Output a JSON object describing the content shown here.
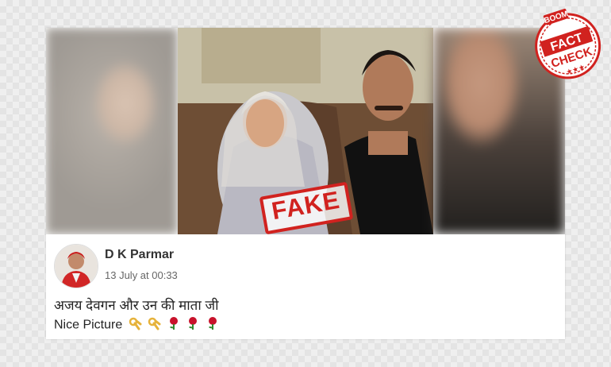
{
  "badge": {
    "top_text": "BOOM",
    "word1": "FACT",
    "word2": "CHECK",
    "stars": "★★★"
  },
  "stamp": {
    "label": "FAKE"
  },
  "post": {
    "author": "D K Parmar",
    "timestamp": "13 July at 00:33",
    "line1": "अजय देवगन और उन की माता जी",
    "line2": "Nice Picture",
    "emoji": [
      "ok-hand",
      "ok-hand",
      "rose",
      "rose",
      "rose"
    ]
  },
  "colors": {
    "stamp_red": "#d1221f",
    "text": "#222222",
    "meta": "#666666"
  }
}
